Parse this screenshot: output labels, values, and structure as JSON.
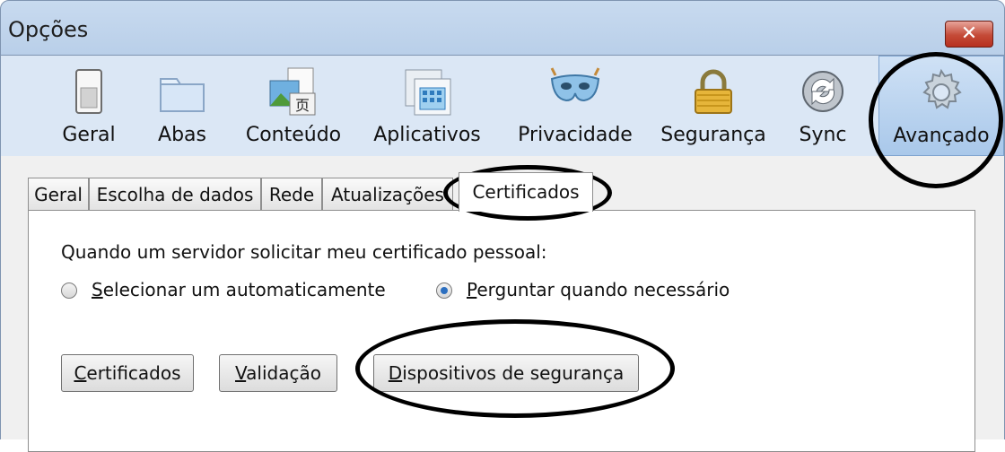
{
  "window": {
    "title": "Opções",
    "close_glyph": "✕"
  },
  "toolbar": {
    "items": [
      {
        "label": "Geral",
        "icon": "switch-icon"
      },
      {
        "label": "Abas",
        "icon": "folder-icon"
      },
      {
        "label": "Conteúdo",
        "icon": "content-icon"
      },
      {
        "label": "Aplicativos",
        "icon": "applications-icon"
      },
      {
        "label": "Privacidade",
        "icon": "mask-icon"
      },
      {
        "label": "Segurança",
        "icon": "lock-icon"
      },
      {
        "label": "Sync",
        "icon": "sync-icon"
      },
      {
        "label": "Avançado",
        "icon": "gear-icon",
        "selected": true
      }
    ]
  },
  "tabs": [
    {
      "label": "Geral"
    },
    {
      "label": "Escolha de dados"
    },
    {
      "label": "Rede"
    },
    {
      "label": "Atualizações"
    },
    {
      "label": "Certificados",
      "active": true
    }
  ],
  "certificates": {
    "prompt": "Quando um servidor solicitar meu certificado pessoal:",
    "option_auto_first": "S",
    "option_auto_rest": "elecionar um automaticamente",
    "option_ask_first": "P",
    "option_ask_rest": "erguntar quando necessário",
    "selected_option": "ask",
    "btn_certs_first": "C",
    "btn_certs_rest": "ertificados",
    "btn_validation_first": "V",
    "btn_validation_rest": "alidação",
    "btn_devices_first": "D",
    "btn_devices_rest": "ispositivos de segurança"
  },
  "colors": {
    "accent": "#2c6fc0",
    "annotation": "#000000"
  }
}
